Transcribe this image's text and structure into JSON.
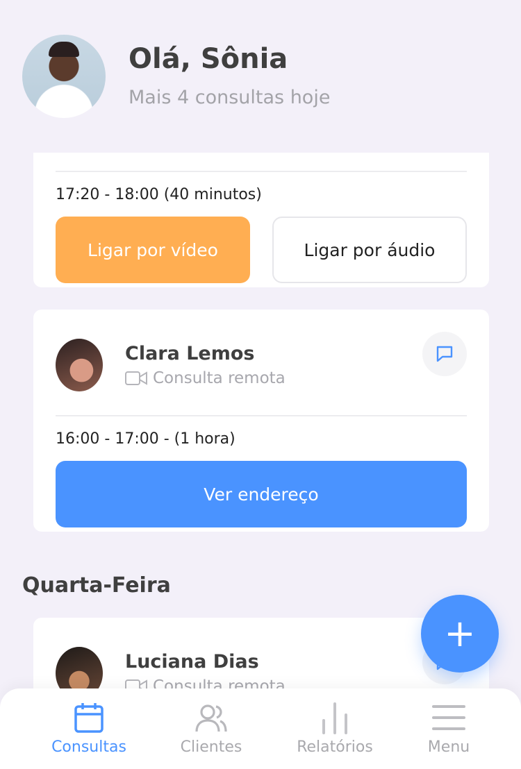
{
  "header": {
    "greeting": "Olá, Sônia",
    "subtitle": "Mais 4 consultas hoje"
  },
  "appointments": [
    {
      "time": "17:20 - 18:00 (40 minutos)",
      "primary_action": "Ligar por vídeo",
      "secondary_action": "Ligar por áudio"
    },
    {
      "name": "Clara Lemos",
      "mode": "Consulta remota",
      "time": "16:00 - 17:00 - (1 hora)",
      "action": "Ver endereço"
    }
  ],
  "sections": [
    {
      "title": "Quarta-Feira",
      "appointments": [
        {
          "name": "Luciana Dias",
          "mode": "Consulta remota"
        }
      ]
    }
  ],
  "fab": {
    "label": "+"
  },
  "nav": {
    "items": [
      {
        "label": "Consultas",
        "icon": "calendar-icon",
        "active": true
      },
      {
        "label": "Clientes",
        "icon": "users-icon",
        "active": false
      },
      {
        "label": "Relatórios",
        "icon": "bar-chart-icon",
        "active": false
      },
      {
        "label": "Menu",
        "icon": "menu-icon",
        "active": false
      }
    ]
  },
  "colors": {
    "accent_blue": "#4a93ff",
    "video_orange": "#ffae52",
    "background": "#f3f0f9"
  }
}
